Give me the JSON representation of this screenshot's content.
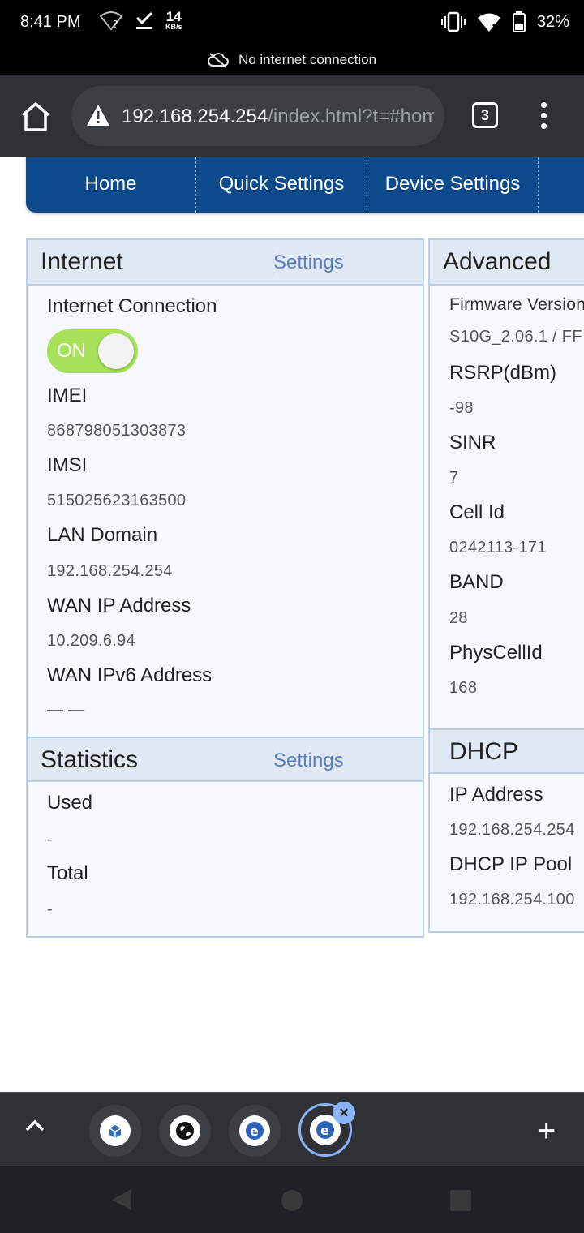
{
  "status_bar": {
    "time": "8:41 PM",
    "speed_value": "14",
    "speed_unit": "KB/s",
    "battery": "32%"
  },
  "offline_banner": {
    "text": "No internet connection"
  },
  "browser": {
    "url_host": "192.168.254.254",
    "url_path": "/index.html?t=#home",
    "tab_count": "3"
  },
  "nav": {
    "items": [
      "Home",
      "Quick Settings",
      "Device Settings"
    ]
  },
  "internet_panel": {
    "title": "Internet",
    "settings_link": "Settings",
    "connection_label": "Internet Connection",
    "toggle_label": "ON",
    "fields": [
      {
        "label": "IMEI",
        "value": "868798051303873"
      },
      {
        "label": "IMSI",
        "value": "515025623163500"
      },
      {
        "label": "LAN Domain",
        "value": "192.168.254.254"
      },
      {
        "label": "WAN IP Address",
        "value": "10.209.6.94"
      },
      {
        "label": "WAN IPv6 Address",
        "value": "— —"
      }
    ]
  },
  "statistics_panel": {
    "title": "Statistics",
    "settings_link": "Settings",
    "fields": [
      {
        "label": "Used",
        "value": "-"
      },
      {
        "label": "Total",
        "value": "-"
      }
    ]
  },
  "advanced_panel": {
    "title": "Advanced",
    "fields": [
      {
        "label": "Firmware Version",
        "value": "S10G_2.06.1 / FF"
      },
      {
        "label": "RSRP(dBm)",
        "value": "-98"
      },
      {
        "label": "SINR",
        "value": "7"
      },
      {
        "label": "Cell Id",
        "value": "0242113-171"
      },
      {
        "label": "BAND",
        "value": "28"
      },
      {
        "label": "PhysCellId",
        "value": "168"
      }
    ]
  },
  "dhcp_panel": {
    "title": "DHCP",
    "fields": [
      {
        "label": "IP Address",
        "value": "192.168.254.254"
      },
      {
        "label": "DHCP IP Pool",
        "value": "192.168.254.100"
      }
    ]
  },
  "icons": {
    "home": "home-icon",
    "warning": "warning-icon",
    "menu": "more-vert-icon",
    "expand": "chevron-up-icon",
    "new_tab": "plus-icon",
    "close": "close-icon"
  }
}
